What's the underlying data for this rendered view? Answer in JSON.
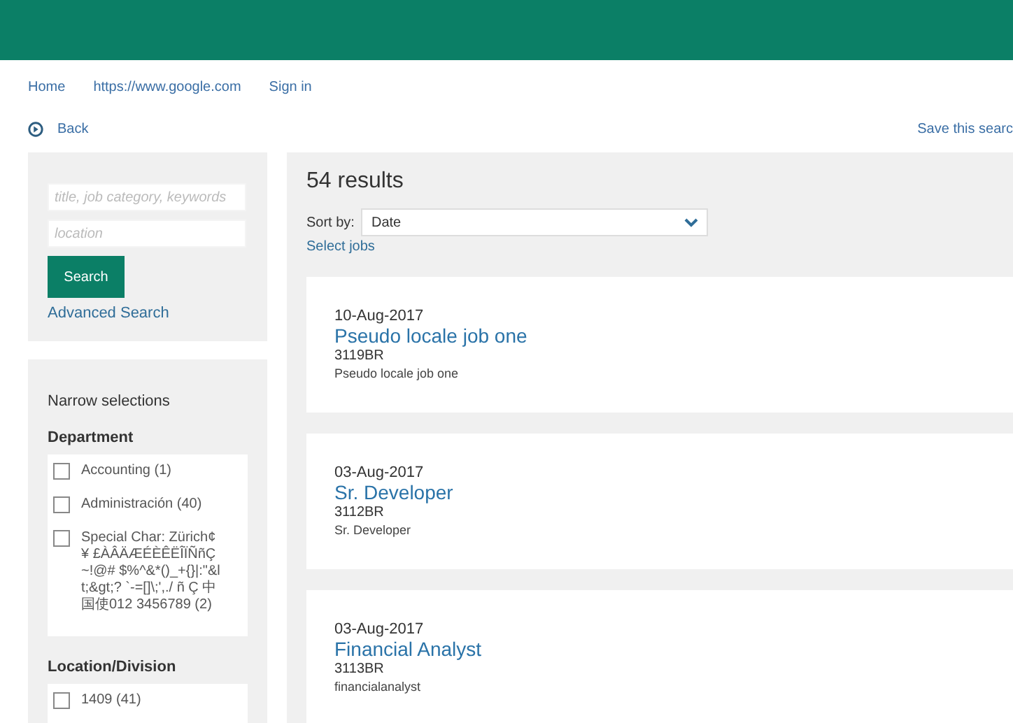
{
  "nav": {
    "links": [
      "Home",
      "https://www.google.com",
      "Sign in"
    ]
  },
  "back": {
    "label": "Back"
  },
  "save_search": {
    "label": "Save this searc"
  },
  "search": {
    "keywords_placeholder": "title, job category, keywords",
    "location_placeholder": "location",
    "button": "Search",
    "advanced": "Advanced Search"
  },
  "filters": {
    "title": "Narrow selections",
    "groups": [
      {
        "heading": "Department",
        "options": [
          {
            "label": "Accounting (1)",
            "checked": false
          },
          {
            "label": "Administración (40)",
            "checked": false
          },
          {
            "label": "Special Char: Zürich¢¥ £ÀÂÄÆÉÈÊËÎÏÑñÇ~!@# $%^&*()_+{}|:\"&lt;&gt;? `-=[]\\;',./ ñ Ç 中国使012 3456789 (2)",
            "checked": false
          }
        ]
      },
      {
        "heading": "Location/Division",
        "options": [
          {
            "label": "1409 (41)",
            "checked": false
          }
        ]
      }
    ]
  },
  "results": {
    "count": "54 results",
    "sort_label": "Sort by:",
    "sort_value": "Date",
    "select_jobs": "Select jobs",
    "jobs": [
      {
        "date": "10-Aug-2017",
        "title": "Pseudo locale job one",
        "code": "3119BR",
        "description": "Pseudo locale job one"
      },
      {
        "date": "03-Aug-2017",
        "title": "Sr. Developer",
        "code": "3112BR",
        "description": "Sr. Developer"
      },
      {
        "date": "03-Aug-2017",
        "title": "Financial Analyst",
        "code": "3113BR",
        "description": "financialanalyst"
      }
    ]
  }
}
